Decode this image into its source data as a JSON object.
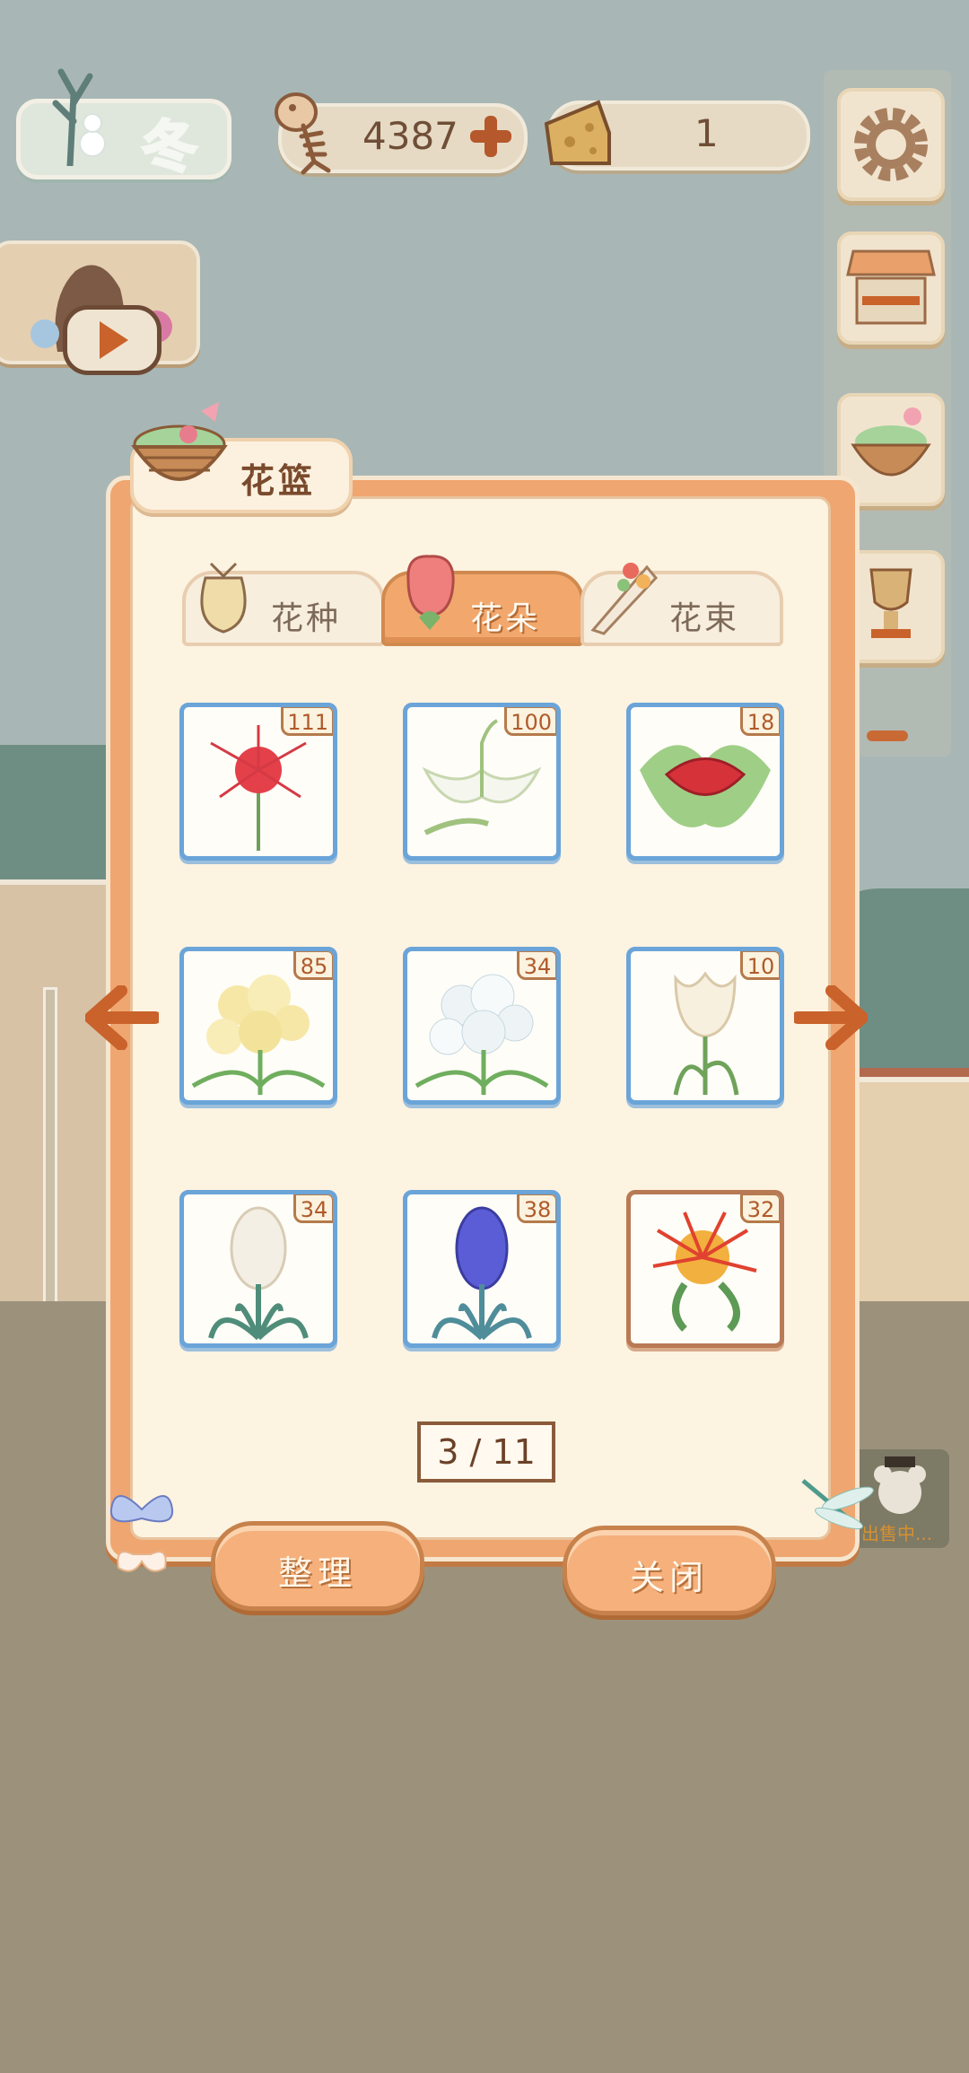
{
  "hud": {
    "season_label": "冬",
    "fish_count": "4387",
    "cheese_count": "1"
  },
  "panel": {
    "title": "花篮",
    "tabs": [
      {
        "label": "花种",
        "active": false
      },
      {
        "label": "花朵",
        "active": true
      },
      {
        "label": "花束",
        "active": false
      }
    ],
    "items": [
      {
        "name": "red-spider-lily",
        "count": "111",
        "frame": "blue"
      },
      {
        "name": "white-egret-orchid",
        "count": "100",
        "frame": "blue"
      },
      {
        "name": "red-lips-flower",
        "count": "18",
        "frame": "blue"
      },
      {
        "name": "yellow-hydrangea",
        "count": "85",
        "frame": "blue"
      },
      {
        "name": "white-hydrangea",
        "count": "34",
        "frame": "blue"
      },
      {
        "name": "white-tulip",
        "count": "10",
        "frame": "blue"
      },
      {
        "name": "white-hyacinth",
        "count": "34",
        "frame": "blue"
      },
      {
        "name": "blue-hyacinth",
        "count": "38",
        "frame": "blue"
      },
      {
        "name": "pincushion-protea",
        "count": "32",
        "frame": "brown"
      }
    ],
    "pager": "3 / 11",
    "sort_button": "整理",
    "close_button": "关闭"
  },
  "side": {
    "mouse_status": "出售中..."
  },
  "colors": {
    "panel_orange": "#f0a670",
    "panel_cream": "#fdf3e1",
    "card_frame_blue": "#6aa4d8",
    "card_frame_brown": "#b87a55",
    "accent_orange": "#c9622b"
  }
}
